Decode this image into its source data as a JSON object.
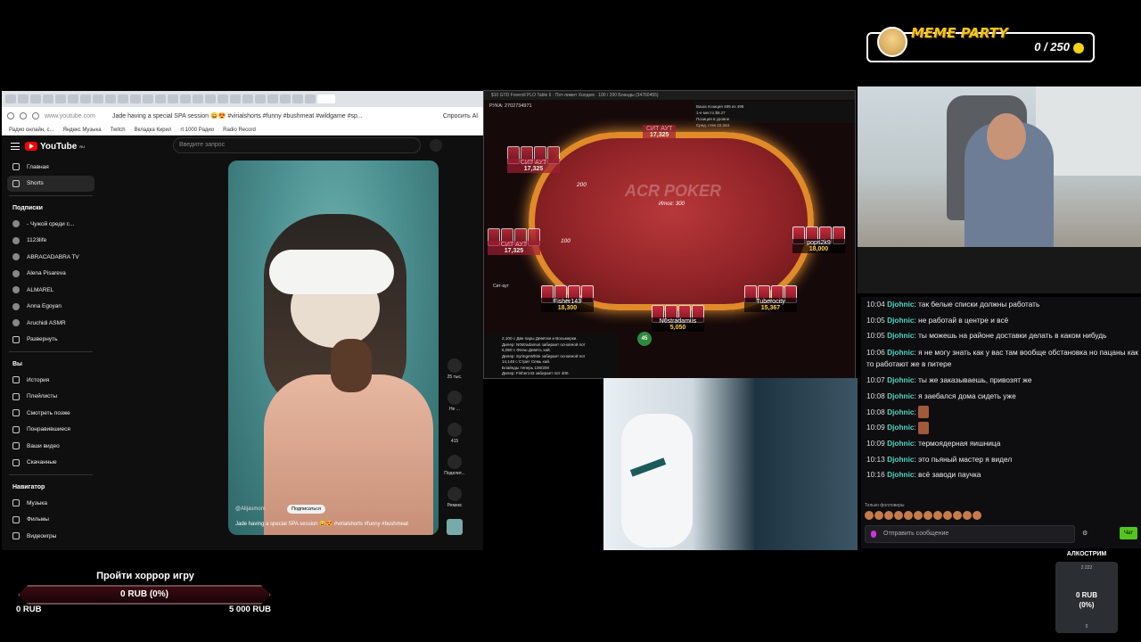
{
  "meme_party": {
    "title": "MEME PARTY",
    "score": "0 / 250"
  },
  "browser": {
    "url": "www.youtube.com",
    "page_title": "Jade having a special SPA session 😄😍 #virialshorts #funny #bushmeat #wildgame #sp...",
    "ask_label": "Спросить Al",
    "bookmarks": [
      "Радио онлайн, с...",
      "Яндекс Музыка",
      "Twitch",
      "Вкладка Кирил",
      "rt 1000 Радио",
      "Radio Record"
    ],
    "search_placeholder": "Введите запрос",
    "logo": "YouTube",
    "logo_suffix": "RU"
  },
  "sidebar": {
    "main": [
      {
        "label": "Главная",
        "icon": "home-icon"
      },
      {
        "label": "Shorts",
        "icon": "shorts-icon",
        "active": true
      }
    ],
    "subs_header": "Подписки",
    "subs": [
      "- Чужой среди с...",
      "1123life",
      "ABRACADABRA TV",
      "Alena Pisareva",
      "ALMAREL",
      "Anna Egoyan",
      "Aruchidi ASMR"
    ],
    "expand": "Развернуть",
    "you_header": "Вы",
    "you": [
      "История",
      "Плейлисты",
      "Смотреть позже",
      "Понравившиеся",
      "Ваши видео",
      "Скачанные"
    ],
    "nav_header": "Навигатор",
    "nav": [
      "Музыка",
      "Фильмы",
      "Видеоигры"
    ]
  },
  "short_video": {
    "channel": "@Alijasmom",
    "subscribe": "Подписаться",
    "caption": "Jade having a special SPA session 😄😍 #virialshorts #funny #bushmeat",
    "actions": [
      {
        "icon": "like-icon",
        "label": "25 тыс."
      },
      {
        "icon": "dislike-icon",
        "label": "Не ..."
      },
      {
        "icon": "comment-icon",
        "label": "415"
      },
      {
        "icon": "share-icon",
        "label": "Поделит..."
      },
      {
        "icon": "remix-icon",
        "label": "Ремикс"
      }
    ]
  },
  "poker": {
    "window_title": "$10 GTD Freeroll PLO Table 6 · Пот-лимит Холдем · 100 / 200 Бланды (34760455)",
    "hand": "РУКА: 2702734971",
    "info": [
      "Ваша позиция 489 из 498",
      "1-е место $9.27",
      "Позиция в уровне",
      "Сред. стек 22,324"
    ],
    "logo": "ACR POKER",
    "total": "Итог: 300",
    "sit_out": "Сит-аут",
    "seats": [
      {
        "name": "СИТ АУТ",
        "stack": "17,325",
        "out": true
      },
      {
        "name": "СИТ АУТ",
        "stack": "17,325",
        "out": true
      },
      {
        "name": "СИТ АУТ",
        "stack": "17,325",
        "out": true
      },
      {
        "name": "pops2k9",
        "stack": "18,000",
        "out": false
      },
      {
        "name": "Fisher143",
        "stack": "18,300",
        "out": false
      },
      {
        "name": "N0stradamus",
        "stack": "5,050",
        "out": false
      },
      {
        "name": "Tuberocity",
        "stack": "15,367",
        "out": false
      }
    ],
    "bets": [
      "200",
      "100"
    ],
    "timebank": "45",
    "log": [
      "2,100 с Две пары Девятки и Восьмерки.",
      "Дилер: N0stradamus забирает основной пот",
      "5,050 с Флеш Девять хай.",
      "Дилер: SyringeWhite забирает основной пот",
      "14,148 с Стрит Семь хай.",
      "Блайнды теперь 100/200",
      "Дилер: Fisher143 забирает пот 400."
    ]
  },
  "chat": {
    "messages": [
      {
        "time": "10:04",
        "nick": "Djohnic",
        "text": "так белые списки должны работать"
      },
      {
        "time": "10:05",
        "nick": "Djohnic",
        "text": "не работай в центре и всё"
      },
      {
        "time": "10:05",
        "nick": "Djohnic",
        "text": "ты можешь на районе доставки делать в каком нибудь"
      },
      {
        "time": "10:06",
        "nick": "Djohnic",
        "text": "я не могу знать как у вас там вообще обстановка но пацаны как то работают же в питере"
      },
      {
        "time": "10:07",
        "nick": "Djohnic",
        "text": "ты же заказываешь, привозят же"
      },
      {
        "time": "10:08",
        "nick": "Djohnic",
        "text": "я заебался дома сидеть уже"
      },
      {
        "time": "10:08",
        "nick": "Djohnic",
        "text": "",
        "emote": true
      },
      {
        "time": "10:09",
        "nick": "Djohnic",
        "text": "",
        "emote": true
      },
      {
        "time": "10:09",
        "nick": "Djohnic",
        "text": "термоядерная яишница"
      },
      {
        "time": "10:13",
        "nick": "Djohnic",
        "text": "это пьяный мастер я видел"
      },
      {
        "time": "10:16",
        "nick": "Djohnic",
        "text": "всё заводи паучка"
      }
    ],
    "followers_only": "Только фолловеры",
    "input_placeholder": "Отправить сообщение",
    "send": "Чат"
  },
  "goal": {
    "title": "Пройти хоррор игру",
    "value": "0 RUB (0%)",
    "progress": 0,
    "min": "0 RUB",
    "max": "5 000 RUB"
  },
  "alkostream": {
    "title": "АЛКОСТРИМ",
    "subtitle": "2 222",
    "amount_line1": "0 RUB",
    "amount_line2": "(0%)",
    "footer": "0"
  }
}
